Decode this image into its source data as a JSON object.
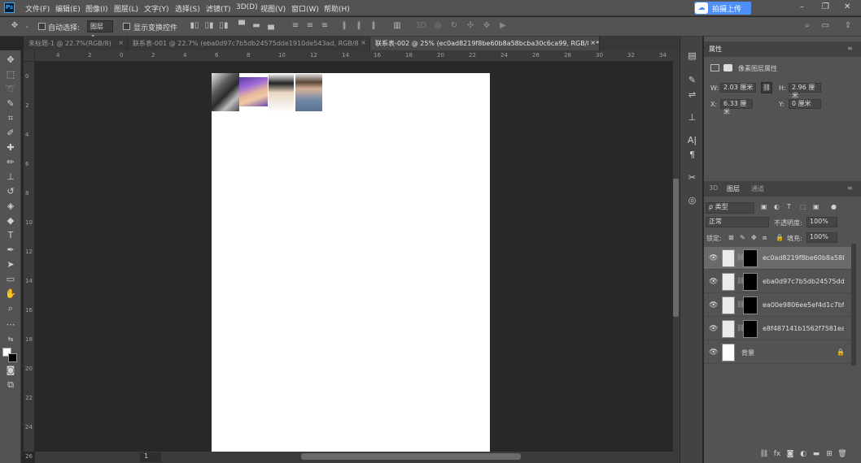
{
  "app": {
    "logo": "Ps"
  },
  "menu": [
    "文件(F)",
    "编辑(E)",
    "图像(I)",
    "图层(L)",
    "文字(Y)",
    "选择(S)",
    "滤镜(T)",
    "3D(D)",
    "视图(V)",
    "窗口(W)",
    "帮助(H)"
  ],
  "upload": {
    "label": "拍摄上传"
  },
  "window_controls": {
    "minimize": "–",
    "restore": "❐",
    "close": "✕"
  },
  "options": {
    "auto_select_label": "自动选择:",
    "auto_select_value": "图层",
    "transform_label": "显示变换控件"
  },
  "tabs": [
    {
      "label": "未标题-1 @ 22.7%(RGB/8)",
      "close": "×",
      "active": false
    },
    {
      "label": "联系表-001 @ 22.7% (eba0d97c7b5db24575dde1910de543ad, RGB/8) *",
      "close": "×",
      "active": false
    },
    {
      "label": "联系表-002 @ 25% (ec0ad8219f8be60b8a58bcba30c6ca99, RGB/8) *",
      "close": "×",
      "active": true
    }
  ],
  "ruler_top": [
    "4",
    "2",
    "0",
    "2",
    "4",
    "6",
    "8",
    "10",
    "12",
    "14",
    "16",
    "18",
    "20",
    "22",
    "24",
    "26",
    "28",
    "30",
    "32",
    "34"
  ],
  "ruler_left": [
    "0",
    "2",
    "4",
    "6",
    "8",
    "10",
    "12",
    "14",
    "16",
    "18",
    "20",
    "22",
    "24",
    "26"
  ],
  "zoom": "1",
  "properties": {
    "title": "属性",
    "subtitle": "像素图层属性",
    "w_label": "W:",
    "w_value": "2.03 厘米",
    "h_label": "H:",
    "h_value": "2.96 厘米",
    "x_label": "X:",
    "x_value": "6.33 厘米",
    "y_label": "Y:",
    "y_value": "0 厘米"
  },
  "layers_panel": {
    "tabs": [
      "3D",
      "图层",
      "通道"
    ],
    "filter_label": "ρ 类型",
    "blend_mode": "正常",
    "opacity_label": "不透明度:",
    "opacity_value": "100%",
    "lock_label": "锁定:",
    "fill_label": "填充:",
    "fill_value": "100%",
    "layers": [
      {
        "name": "ec0ad8219f8be60b8a58bc...",
        "selected": true
      },
      {
        "name": "eba0d97c7b5db24575dde...",
        "selected": false
      },
      {
        "name": "ea00e9806ee5ef4d1c7bfa...",
        "selected": false
      },
      {
        "name": "e8f487141b1562f7581ea7...",
        "selected": false
      }
    ],
    "background_layer": "背景"
  }
}
